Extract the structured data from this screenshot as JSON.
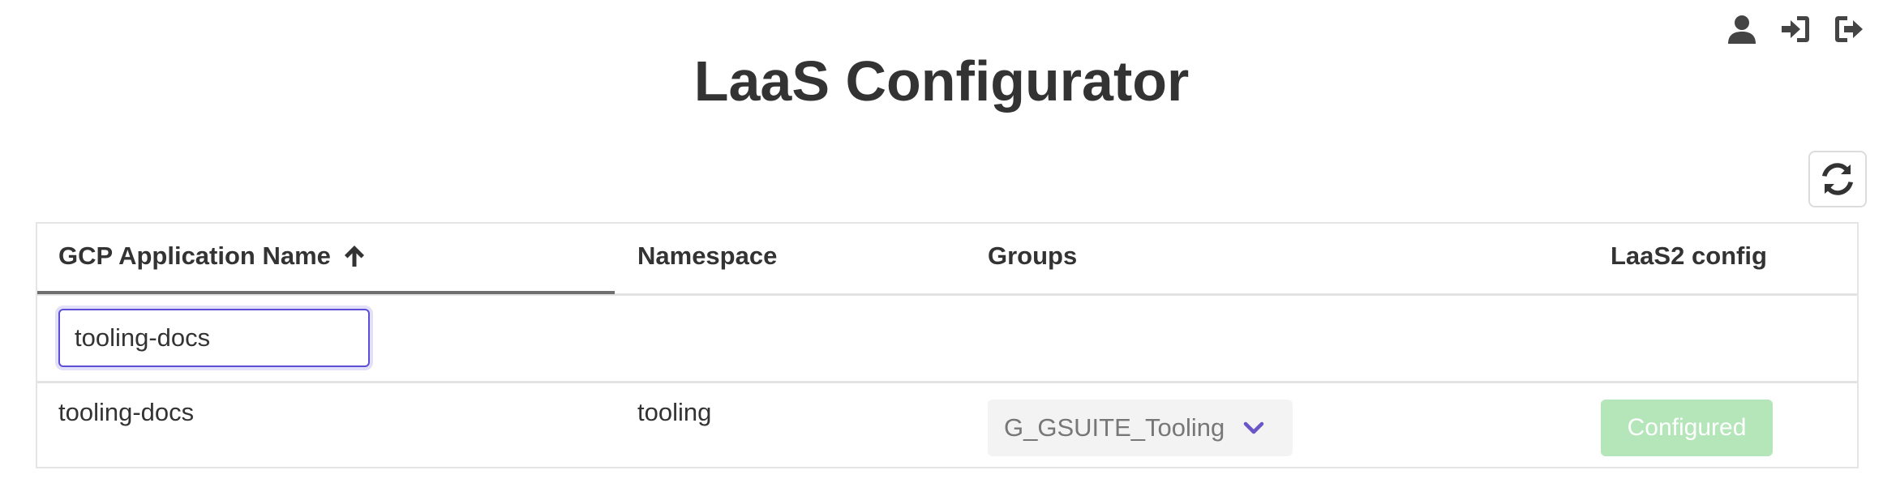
{
  "header": {
    "title": "LaaS Configurator",
    "icons": [
      "user-icon",
      "sign-in-icon",
      "sign-out-icon"
    ]
  },
  "toolbar": {
    "refresh_icon": "refresh-icon"
  },
  "table": {
    "columns": [
      {
        "label": "GCP Application Name",
        "sorted": "ascending"
      },
      {
        "label": "Namespace"
      },
      {
        "label": "Groups"
      },
      {
        "label": "LaaS2 config"
      }
    ],
    "filter": {
      "value": "tooling-docs"
    },
    "rows": [
      {
        "app_name": "tooling-docs",
        "namespace": "tooling",
        "group": "G_GSUITE_Tooling",
        "config_status": "Configured"
      }
    ]
  },
  "colors": {
    "accent": "#5b4fd6",
    "configured_bg": "#b4e6b9",
    "chevron": "#6a55c9"
  }
}
